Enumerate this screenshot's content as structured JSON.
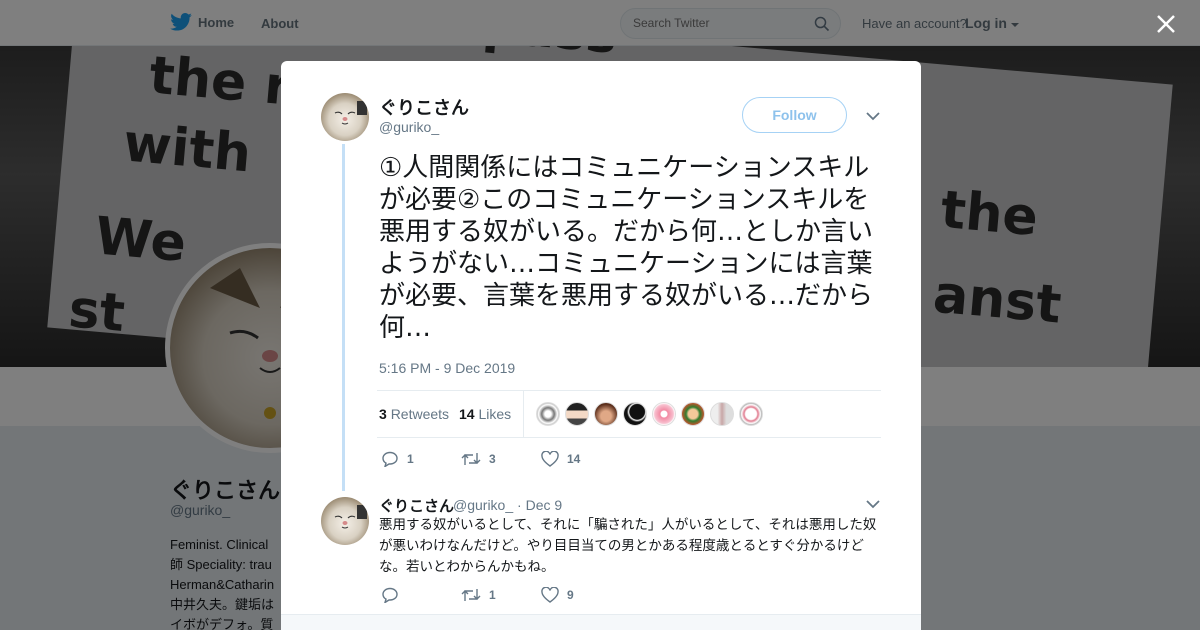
{
  "nav": {
    "home_label": "Home",
    "about_label": "About",
    "search_placeholder": "Search Twitter",
    "account_text": "Have an account?",
    "login_label": "Log in"
  },
  "banner": {
    "lines": [
      "Our start & pass",
      "the r",
      "with",
      "We",
      "the",
      "st",
      "anst"
    ]
  },
  "profile": {
    "name": "ぐりこさん",
    "handle": "@guriko_",
    "bio_lines": [
      "Feminist. Clinical",
      "師 Speciality: trau",
      "Herman&Catharin",
      "中井久夫。鍵垢は",
      "イボがデフォ。質"
    ]
  },
  "tweet": {
    "name": "ぐりこさん",
    "handle": "@guriko_",
    "follow_label": "Follow",
    "text": "①人間関係にはコミュニケーションスキルが必要②このコミュニケーションスキルを悪用する奴がいる。だから何…としか言いようがない…コミュニケーションには言葉が必要、言葉を悪用する奴がいる…だから何…",
    "timestamp": "5:16 PM - 9 Dec 2019",
    "retweets_count": "3",
    "retweets_label": "Retweets",
    "likes_count": "14",
    "likes_label": "Likes",
    "reply_count": "1",
    "retweet_count": "3",
    "like_count": "14"
  },
  "reply": {
    "name": "ぐりこさん",
    "handle": "@guriko_",
    "sep": "·",
    "date": "Dec 9",
    "text": "悪用する奴がいるとして、それに「騙された」人がいるとして、それは悪用した奴が悪いわけなんだけど。やり目目当ての男とかある程度歳とるとすぐ分かるけどな。若いとわからんかもね。",
    "reply_count": "",
    "retweet_count": "1",
    "like_count": "9"
  },
  "colors": {
    "twitter_blue": "#1da1f2",
    "muted": "#657786",
    "thread_line": "#c4dff6"
  }
}
